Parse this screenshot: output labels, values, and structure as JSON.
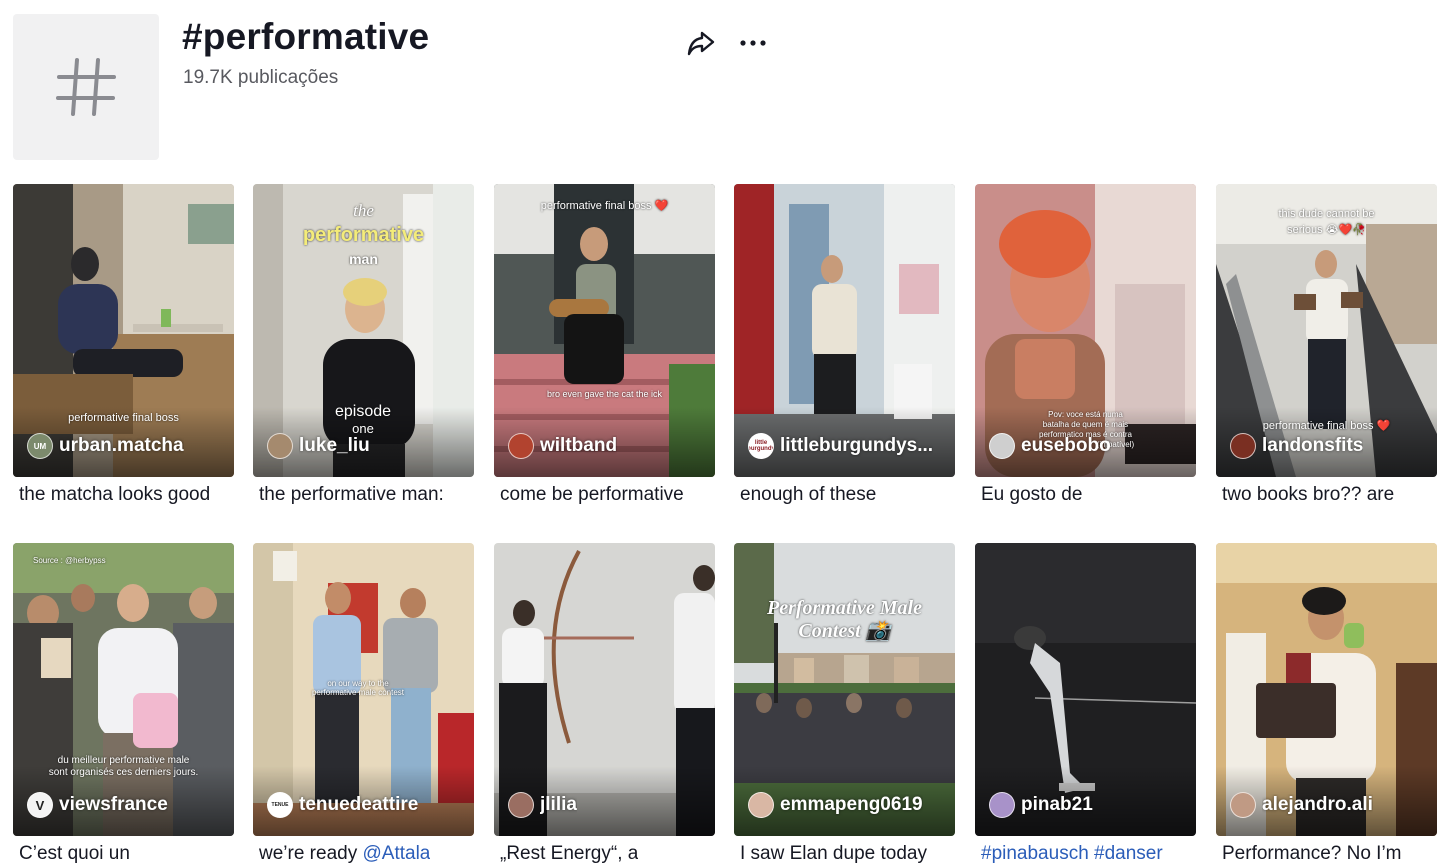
{
  "header": {
    "title": "#performative",
    "post_count": "19.7K publicações",
    "share_icon": "share-arrow-icon",
    "more_icon": "more-dots-icon"
  },
  "videos": [
    {
      "username": "urban.matcha",
      "avatar_text": "UM",
      "overlay": "performative final boss",
      "description": "the matcha looks good"
    },
    {
      "username": "luke_liu",
      "overlay_small": "the",
      "overlay_title": "performative",
      "overlay_sub": "man",
      "overlay_ep": "episode",
      "overlay_ep2": "one",
      "description": "the performative man:"
    },
    {
      "username": "wiltband",
      "overlay": "performative final boss ❤️",
      "overlay2": "bro even gave the cat the ick",
      "description": "come be performative"
    },
    {
      "username": "littleburgundys...",
      "avatar_text": "little burgundy",
      "description": "enough of these"
    },
    {
      "username": "eusebobo",
      "overlay": "Pov: voce está numa",
      "overlay2": "batalha de quem é mais",
      "overlay3": "performatico mas é contra",
      "overlay4": "(imbatível)",
      "description": "Eu gosto de"
    },
    {
      "username": "landonsfits",
      "overlay": "this dude cannot be",
      "overlay2": "serious 😭❤️🥀",
      "overlay3": "performative final boss ❤️",
      "description": "two books bro?? are"
    },
    {
      "username": "viewsfrance",
      "overlay": "Source : @herbypss",
      "overlay2": "du meilleur performative male",
      "overlay3": "sont organisés ces derniers jours.",
      "description": "C’est quoi un"
    },
    {
      "username": "tenuedeattire",
      "avatar_text": "TENUE",
      "overlay": "on our way to the",
      "overlay2": "performative male contest",
      "description_prefix": "we’re ready ",
      "description_link": "@Attala"
    },
    {
      "username": "jlilia",
      "description": "„Rest Energy“, a"
    },
    {
      "username": "emmapeng0619",
      "overlay": "Performative Male",
      "overlay2": "Contest 📸",
      "description": "I saw Elan dupe today"
    },
    {
      "username": "pinab21",
      "description": "#pinabausch #danser"
    },
    {
      "username": "alejandro.ali",
      "description": "Performance? No I’m"
    }
  ],
  "colors": {
    "title": "#161823",
    "secondary": "#58595f",
    "link": "#2b5db9",
    "placeholder_bg": "#f1f1f2"
  }
}
